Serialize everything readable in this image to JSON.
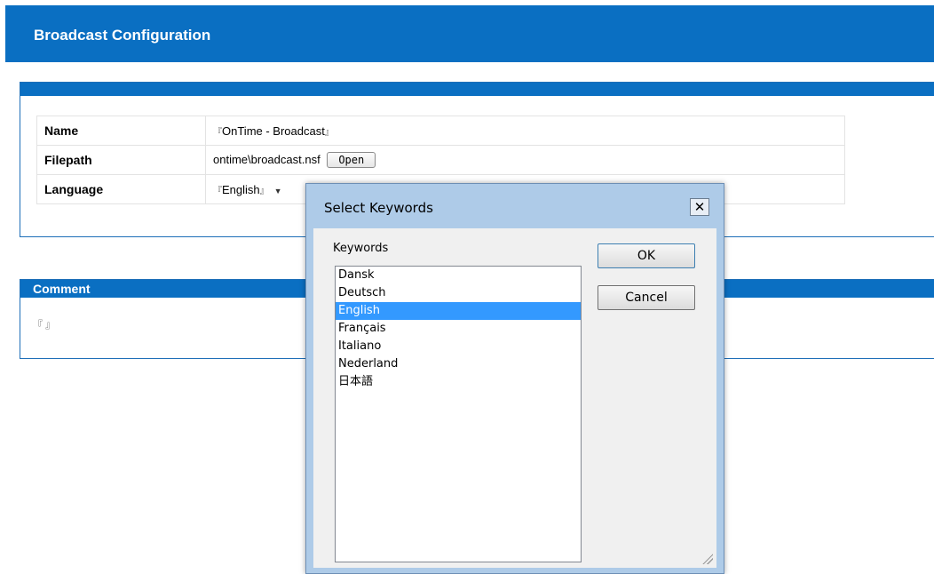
{
  "header": {
    "title": "Broadcast Configuration"
  },
  "form": {
    "name_label": "Name",
    "name_value": "OnTime - Broadcast",
    "filepath_label": "Filepath",
    "filepath_value": "ontime\\broadcast.nsf",
    "open_label": "Open",
    "language_label": "Language",
    "language_value": "English"
  },
  "comment": {
    "heading": "Comment"
  },
  "dialog": {
    "title": "Select Keywords",
    "close_glyph": "✕",
    "keywords_label": "Keywords",
    "options": [
      "Dansk",
      "Deutsch",
      "English",
      "Français",
      "Italiano",
      "Nederland",
      "日本語"
    ],
    "selected": "English",
    "ok_label": "OK",
    "cancel_label": "Cancel"
  },
  "colors": {
    "brand": "#0a6fc2",
    "selection": "#3399ff"
  }
}
